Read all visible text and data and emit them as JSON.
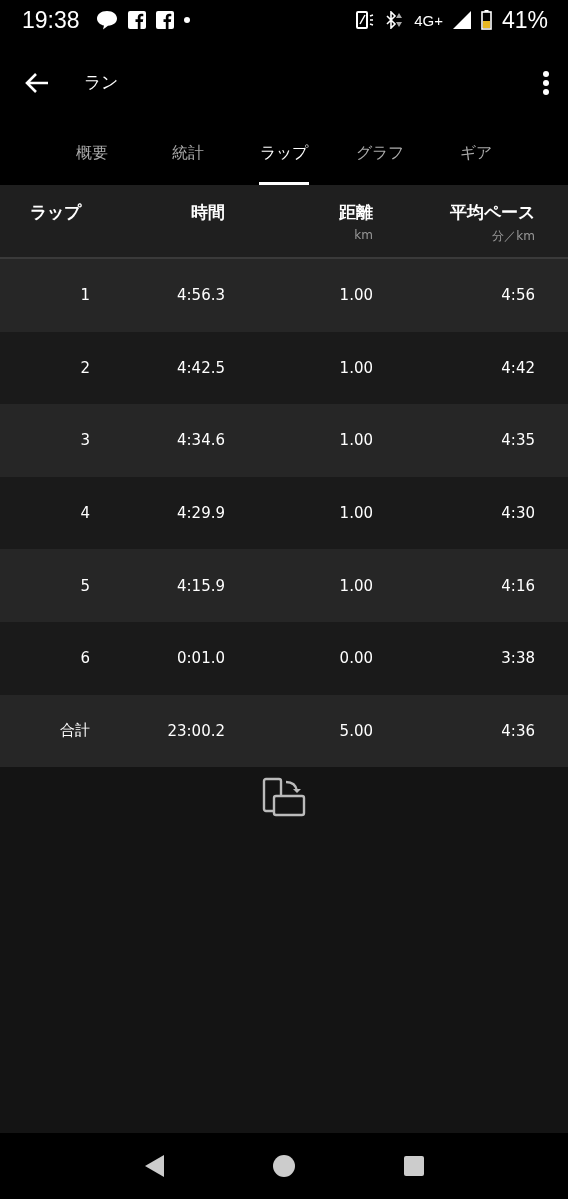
{
  "status_bar": {
    "time": "19:38",
    "network": "4G+",
    "battery": "41%"
  },
  "app_bar": {
    "title": "ラン"
  },
  "tabs": [
    {
      "label": "概要",
      "selected": false
    },
    {
      "label": "統計",
      "selected": false
    },
    {
      "label": "ラップ",
      "selected": true
    },
    {
      "label": "グラフ",
      "selected": false
    },
    {
      "label": "ギア",
      "selected": false
    }
  ],
  "table": {
    "columns": [
      {
        "label": "ラップ"
      },
      {
        "label": "時間"
      },
      {
        "label": "距離",
        "unit": "km"
      },
      {
        "label": "平均ペース",
        "unit": "分／km"
      }
    ],
    "rows": [
      {
        "lap": "1",
        "time": "4:56.3",
        "distance": "1.00",
        "pace": "4:56"
      },
      {
        "lap": "2",
        "time": "4:42.5",
        "distance": "1.00",
        "pace": "4:42"
      },
      {
        "lap": "3",
        "time": "4:34.6",
        "distance": "1.00",
        "pace": "4:35"
      },
      {
        "lap": "4",
        "time": "4:29.9",
        "distance": "1.00",
        "pace": "4:30"
      },
      {
        "lap": "5",
        "time": "4:15.9",
        "distance": "1.00",
        "pace": "4:16"
      },
      {
        "lap": "6",
        "time": "0:01.0",
        "distance": "0.00",
        "pace": "3:38"
      },
      {
        "lap": "合計",
        "time": "23:00.2",
        "distance": "5.00",
        "pace": "4:36"
      }
    ]
  }
}
